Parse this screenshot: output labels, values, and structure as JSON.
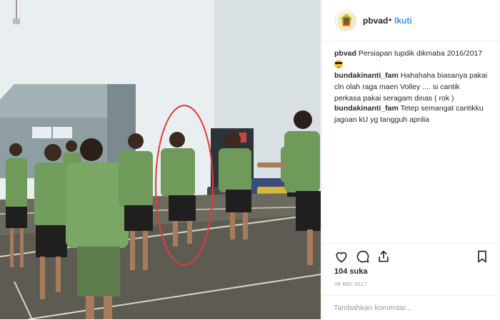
{
  "header": {
    "username": "pbvad",
    "separator": "•",
    "follow_label": "Ikuti",
    "avatar_icon": "emblem-icon"
  },
  "comments": [
    {
      "user": "pbvad",
      "text": "Persiapan tupdik dikmaba 2016/2017",
      "emoji": "sunglasses-emoji"
    },
    {
      "user": "bundakinanti_fam",
      "text": "Hahahaha biasanya pakai cln olah raga maen Volley .... si cantik perkasa pakai seragam dinas ( rok )"
    },
    {
      "user": "bundakinanti_fam",
      "text": "Tetep semangat cantikku jagoan kU yg tangguh aprilia"
    }
  ],
  "actions": {
    "like_icon": "heart-icon",
    "comment_icon": "comment-bubble-icon",
    "share_icon": "share-icon",
    "save_icon": "bookmark-icon",
    "likes": "104 suka",
    "date": "28 MEI 2017"
  },
  "composer": {
    "placeholder": "Tambahkan komentar..."
  },
  "colors": {
    "accent": "#3897f0",
    "uniform": "#6f9a5a",
    "skirt": "#1f1f1f",
    "annotation": "#e23a3a"
  }
}
